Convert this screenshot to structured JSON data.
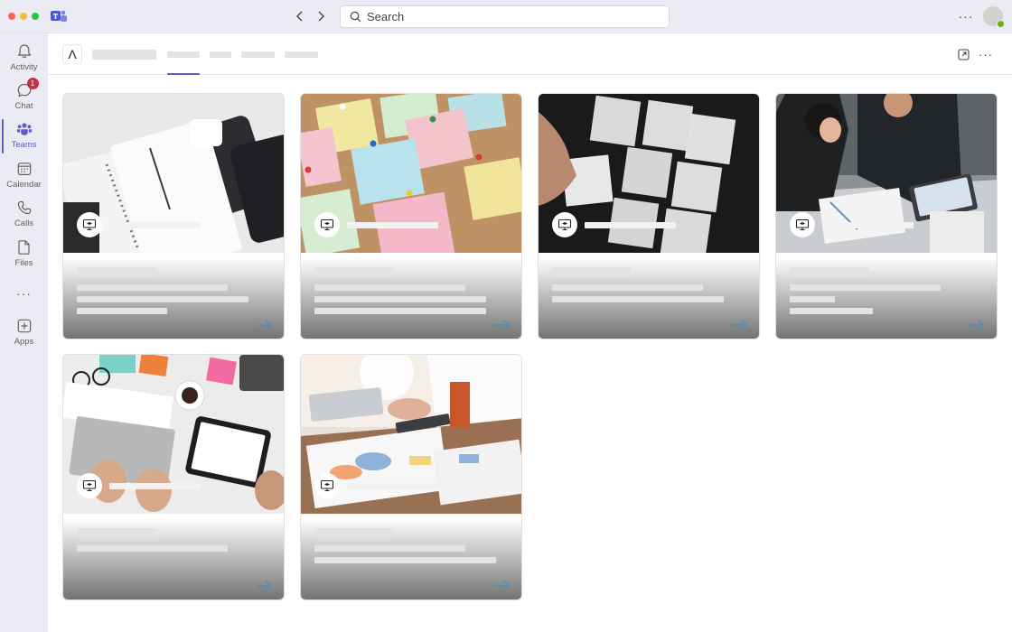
{
  "titlebar": {
    "search_placeholder": "Search"
  },
  "rail": {
    "items": [
      {
        "label": "Activity",
        "icon": "bell-icon"
      },
      {
        "label": "Chat",
        "icon": "chat-icon",
        "badge": "1"
      },
      {
        "label": "Teams",
        "icon": "teams-icon",
        "active": true
      },
      {
        "label": "Calendar",
        "icon": "calendar-icon"
      },
      {
        "label": "Calls",
        "icon": "phone-icon"
      },
      {
        "label": "Files",
        "icon": "file-icon"
      },
      {
        "label": "Apps",
        "icon": "add-apps-icon"
      }
    ],
    "more": "···"
  },
  "header": {
    "logo_glyph": "Λ",
    "more": "···"
  },
  "colors": {
    "accent": "#5b5fc7",
    "badge": "#c4314b",
    "presence": "#6bb700",
    "arrow": "#4a90b8"
  },
  "cards": [
    {
      "image": "notebook-phones-desk",
      "icon": "training-board-icon"
    },
    {
      "image": "sticky-notes-corkboard",
      "icon": "training-board-icon"
    },
    {
      "image": "paper-notes-dark",
      "icon": "training-board-icon"
    },
    {
      "image": "meeting-documents",
      "icon": "training-board-icon"
    },
    {
      "image": "laptop-tablet-desk",
      "icon": "training-board-icon"
    },
    {
      "image": "charts-on-table",
      "icon": "training-board-icon"
    }
  ]
}
